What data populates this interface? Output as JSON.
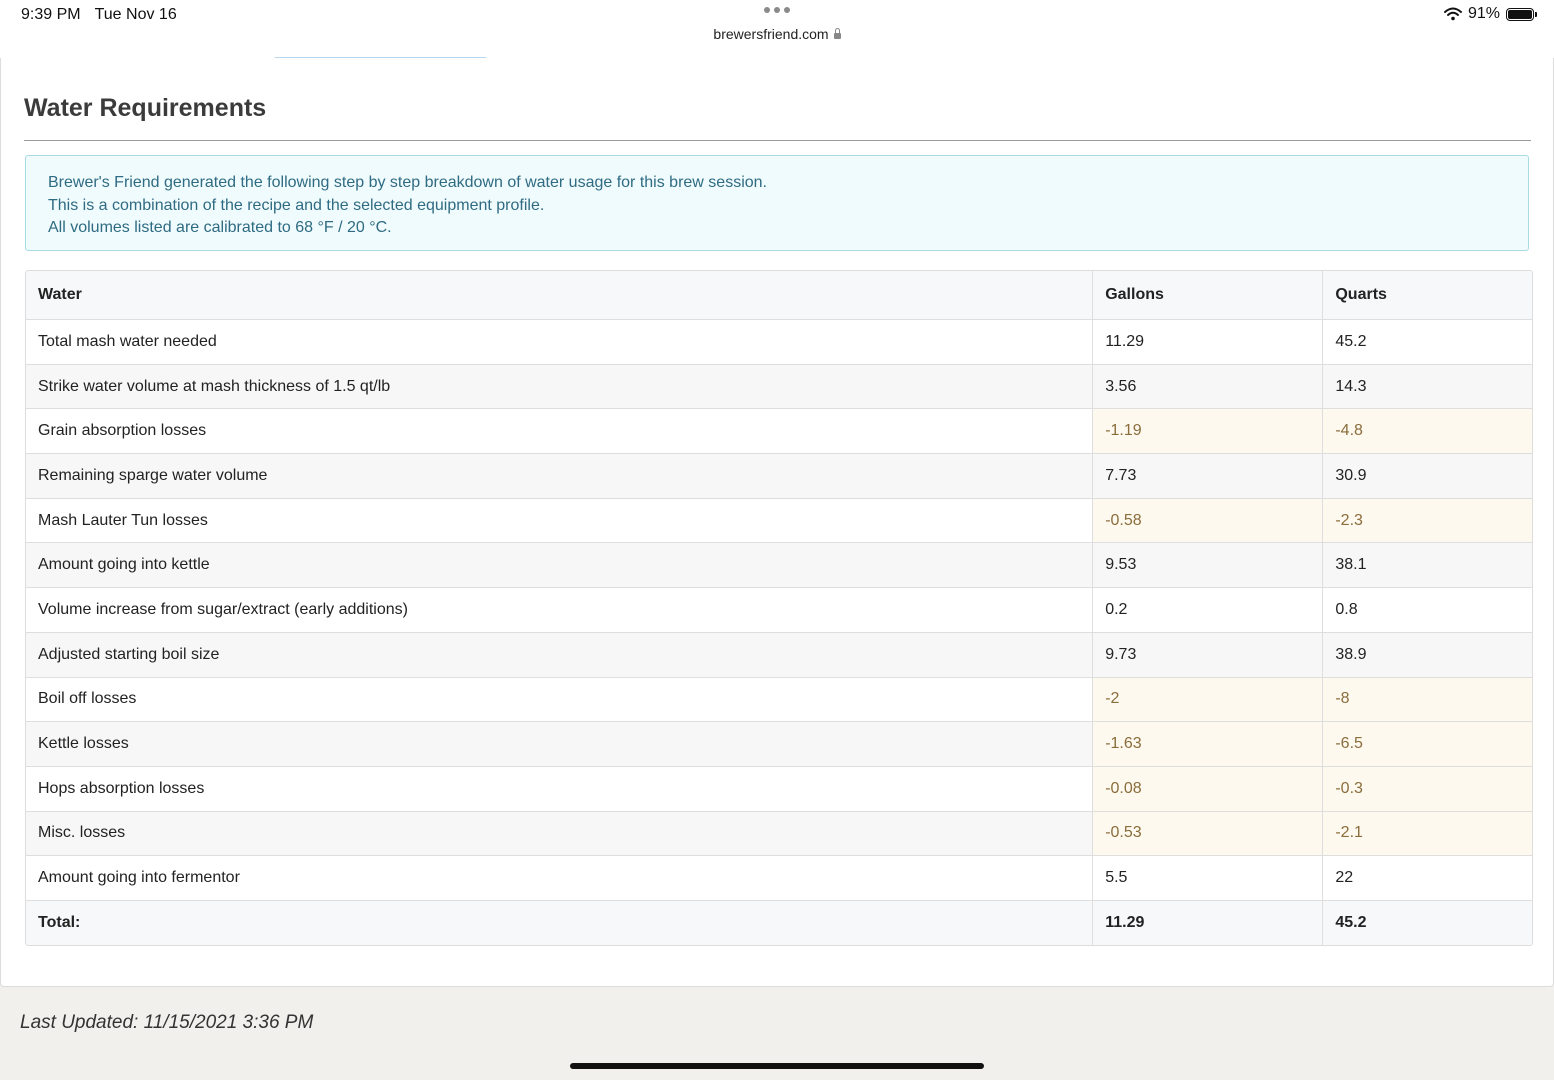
{
  "status_bar": {
    "time": "9:39 PM",
    "date": "Tue Nov 16",
    "url": "brewersfriend.com",
    "battery": "91%",
    "battery_level": 0.91
  },
  "section": {
    "title": "Water Requirements"
  },
  "info": {
    "lines": [
      "Brewer's Friend generated the following step by step breakdown of water usage for this brew session.",
      "This is a combination of the recipe and the selected equipment profile.",
      "All volumes listed are calibrated to 68 °F / 20 °C."
    ]
  },
  "table": {
    "headers": [
      "Water",
      "Gallons",
      "Quarts"
    ],
    "rows": [
      {
        "label": "Total mash water needed",
        "gallons": "11.29",
        "quarts": "45.2"
      },
      {
        "label": "Strike water volume at mash thickness of 1.5 qt/lb",
        "gallons": "3.56",
        "quarts": "14.3"
      },
      {
        "label": "Grain absorption losses",
        "gallons": "-1.19",
        "quarts": "-4.8"
      },
      {
        "label": "Remaining sparge water volume",
        "gallons": "7.73",
        "quarts": "30.9"
      },
      {
        "label": "Mash Lauter Tun losses",
        "gallons": "-0.58",
        "quarts": "-2.3"
      },
      {
        "label": "Amount going into kettle",
        "gallons": "9.53",
        "quarts": "38.1"
      },
      {
        "label": "Volume increase from sugar/extract (early additions)",
        "gallons": "0.2",
        "quarts": "0.8"
      },
      {
        "label": "Adjusted starting boil size",
        "gallons": "9.73",
        "quarts": "38.9"
      },
      {
        "label": "Boil off losses",
        "gallons": "-2",
        "quarts": "-8"
      },
      {
        "label": "Kettle losses",
        "gallons": "-1.63",
        "quarts": "-6.5"
      },
      {
        "label": "Hops absorption losses",
        "gallons": "-0.08",
        "quarts": "-0.3"
      },
      {
        "label": "Misc. losses",
        "gallons": "-0.53",
        "quarts": "-2.1"
      },
      {
        "label": "Amount going into fermentor",
        "gallons": "5.5",
        "quarts": "22"
      }
    ],
    "total": {
      "label": "Total:",
      "gallons": "11.29",
      "quarts": "45.2"
    }
  },
  "footer": {
    "last_updated": "Last Updated: 11/15/2021 3:36 PM"
  },
  "colors": {
    "info_text": "#2f6b82",
    "info_bg": "#f0fbfd",
    "negative_bg": "#fdf9ef",
    "negative_text": "#8a6d3b"
  }
}
